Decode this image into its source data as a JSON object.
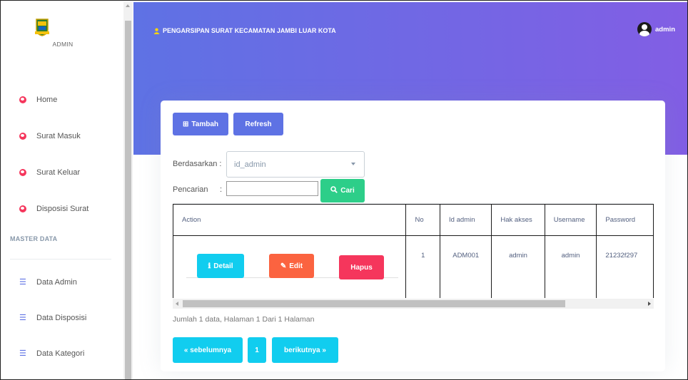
{
  "sidebar": {
    "role_label": "ADMIN",
    "items": [
      {
        "label": "Home",
        "icon": "user-circle-icon"
      },
      {
        "label": "Surat Masuk",
        "icon": "user-circle-icon"
      },
      {
        "label": "Surat Keluar",
        "icon": "user-circle-icon"
      },
      {
        "label": "Disposisi Surat",
        "icon": "user-circle-icon"
      }
    ],
    "section_title": "MASTER DATA",
    "master_items": [
      {
        "label": "Data Admin",
        "icon": "list-icon"
      },
      {
        "label": "Data Disposisi",
        "icon": "list-icon"
      },
      {
        "label": "Data Kategori",
        "icon": "list-icon"
      }
    ]
  },
  "header": {
    "title": "PENGARSIPAN SURAT KECAMATAN JAMBI LUAR KOTA",
    "user": "admin"
  },
  "toolbar": {
    "add_label": "Tambah",
    "refresh_label": "Refresh"
  },
  "filter": {
    "field_label": "Berdasarkan :",
    "field_value": "id_admin",
    "search_label": "Pencarian",
    "search_sep": ":",
    "search_value": "",
    "search_button": "Cari"
  },
  "table": {
    "columns": [
      "Action",
      "No",
      "Id admin",
      "Hak akses",
      "Username",
      "Password"
    ],
    "rows": [
      {
        "no": "1",
        "id_admin": "ADM001",
        "hak_akses": "admin",
        "username": "admin",
        "password": "21232f297",
        "actions": {
          "detail": "Detail",
          "edit": "Edit",
          "hapus": "Hapus"
        }
      }
    ]
  },
  "summary": "Jumlah 1 data, Halaman 1 Dari 1 Halaman",
  "pagination": {
    "prev": "« sebelumnya",
    "page": "1",
    "next": "berikutnya »"
  },
  "colors": {
    "primary": "#5e72e4",
    "gradient_end": "#825ee4",
    "info": "#11cdef",
    "warning": "#fb6340",
    "danger": "#f5365c",
    "success": "#2dce89"
  }
}
